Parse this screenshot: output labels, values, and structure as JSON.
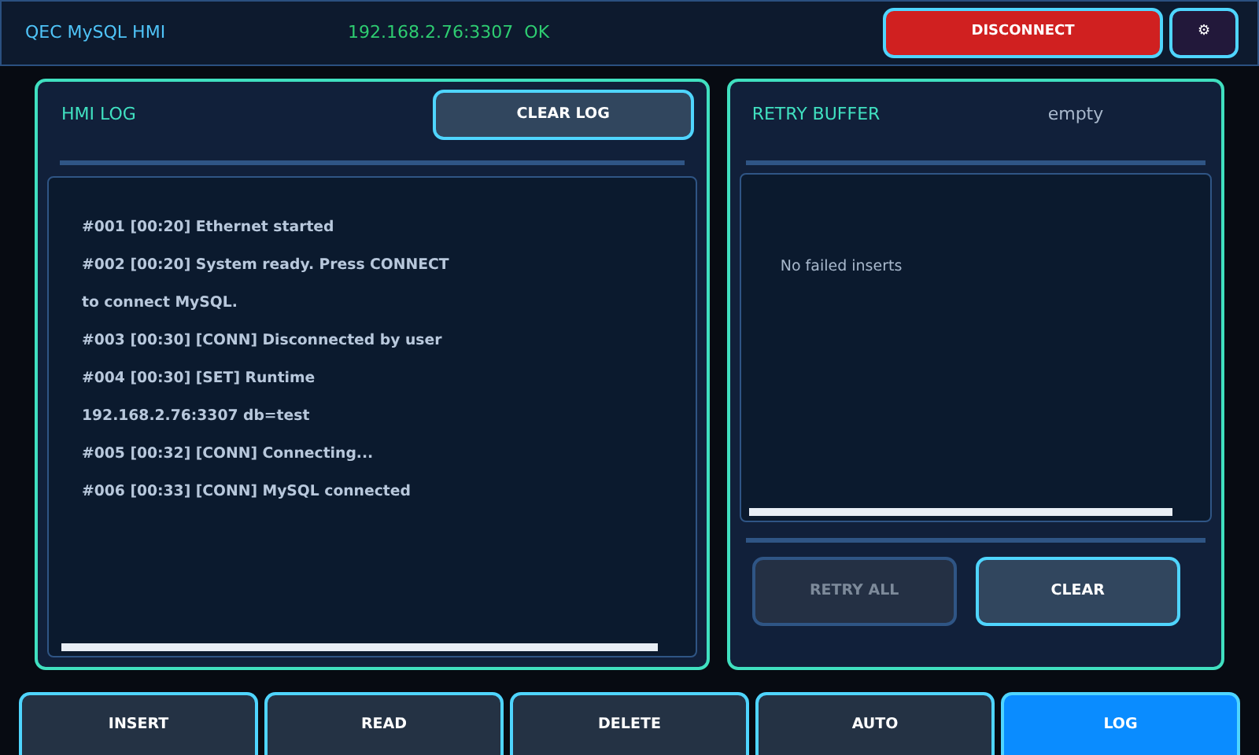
{
  "header": {
    "title": "QEC MySQL HMI",
    "connection": "192.168.2.76:3307  OK",
    "disconnect_button": "DISCONNECT",
    "settings_button": "⚙"
  },
  "log_panel": {
    "title": "HMI LOG",
    "clear_button": "CLEAR LOG",
    "entries": [
      "#001 [00:20] Ethernet started",
      "#002 [00:20] System ready. Press CONNECT to connect MySQL.",
      "#003 [00:30] [CONN] Disconnected by user",
      "#004 [00:30] [SET] Runtime 192.168.2.76:3307 db=test",
      "#005 [00:32] [CONN] Connecting...",
      "#006 [00:33] [CONN] MySQL connected"
    ]
  },
  "retry_panel": {
    "title": "RETRY BUFFER",
    "status": "empty",
    "empty_message": "No failed inserts",
    "buttons": [
      {
        "label": "RETRY ALL",
        "disabled": true
      },
      {
        "label": "CLEAR",
        "disabled": false
      }
    ]
  },
  "nav": [
    {
      "label": "INSERT",
      "selected": false
    },
    {
      "label": "READ",
      "selected": false
    },
    {
      "label": "DELETE",
      "selected": false
    },
    {
      "label": "AUTO",
      "selected": false
    },
    {
      "label": "LOG",
      "selected": true
    }
  ]
}
